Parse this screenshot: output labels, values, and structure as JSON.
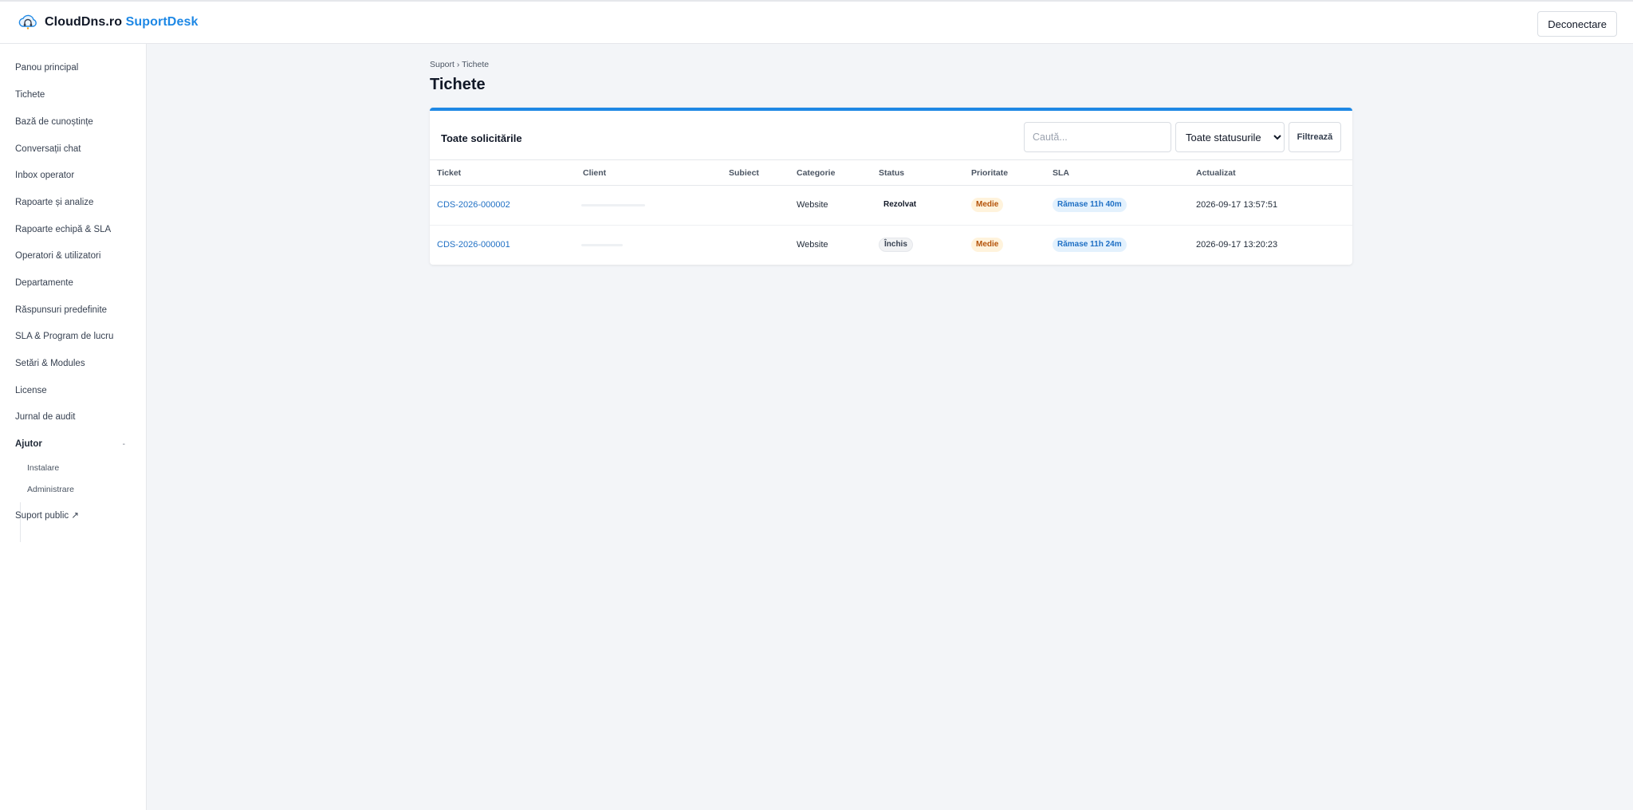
{
  "brand": {
    "name": "CloudDns.ro",
    "product": "SuportDesk"
  },
  "header": {
    "logout_label": "Deconectare"
  },
  "sidebar": {
    "items": [
      {
        "label": "Panou principal"
      },
      {
        "label": "Tichete"
      },
      {
        "label": "Bază de cunoștințe"
      },
      {
        "label": "Conversații chat"
      },
      {
        "label": "Inbox operator"
      },
      {
        "label": "Rapoarte și analize"
      },
      {
        "label": "Rapoarte echipă & SLA"
      },
      {
        "label": "Operatori & utilizatori"
      },
      {
        "label": "Departamente"
      },
      {
        "label": "Răspunsuri predefinite"
      },
      {
        "label": "SLA & Program de lucru"
      },
      {
        "label": "Setări & Modules"
      },
      {
        "label": "License"
      },
      {
        "label": "Jurnal de audit"
      }
    ],
    "group": {
      "label": "Ajutor",
      "toggle": "-",
      "items": [
        {
          "label": "Instalare"
        },
        {
          "label": "Administrare"
        }
      ]
    },
    "public_link": "Suport public ↗"
  },
  "breadcrumb": "Suport › Tichete",
  "page_title": "Tichete",
  "card": {
    "title": "Toate solicitările",
    "search_placeholder": "Caută...",
    "status_filter": {
      "selected": "Toate statusurile"
    },
    "filter_button": "Filtrează"
  },
  "table": {
    "columns": [
      "Ticket",
      "Client",
      "Subiect",
      "Categorie",
      "Status",
      "Prioritate",
      "SLA",
      "Actualizat"
    ],
    "rows": [
      {
        "ticket": "CDS-2026-000002",
        "client": "",
        "subject": "",
        "category": "Website",
        "status": "Rezolvat",
        "priority": "Medie",
        "sla": "Rămase 11h 40m",
        "updated": "2026-09-17 13:57:51"
      },
      {
        "ticket": "CDS-2026-000001",
        "client": "",
        "subject": "",
        "category": "Website",
        "status": "Închis",
        "priority": "Medie",
        "sla": "Rămase 11h 24m",
        "updated": "2026-09-17 13:20:23"
      }
    ]
  },
  "colors": {
    "accent": "#1e88e5",
    "link": "#1e6fc4",
    "priority_medium": "#b45309",
    "sla_bg": "#e3f1fd"
  },
  "icons": {
    "brand_logo": "cloud-headset-icon",
    "external_link": "arrow-up-right-icon",
    "select_chevron": "chevron-down-icon"
  }
}
